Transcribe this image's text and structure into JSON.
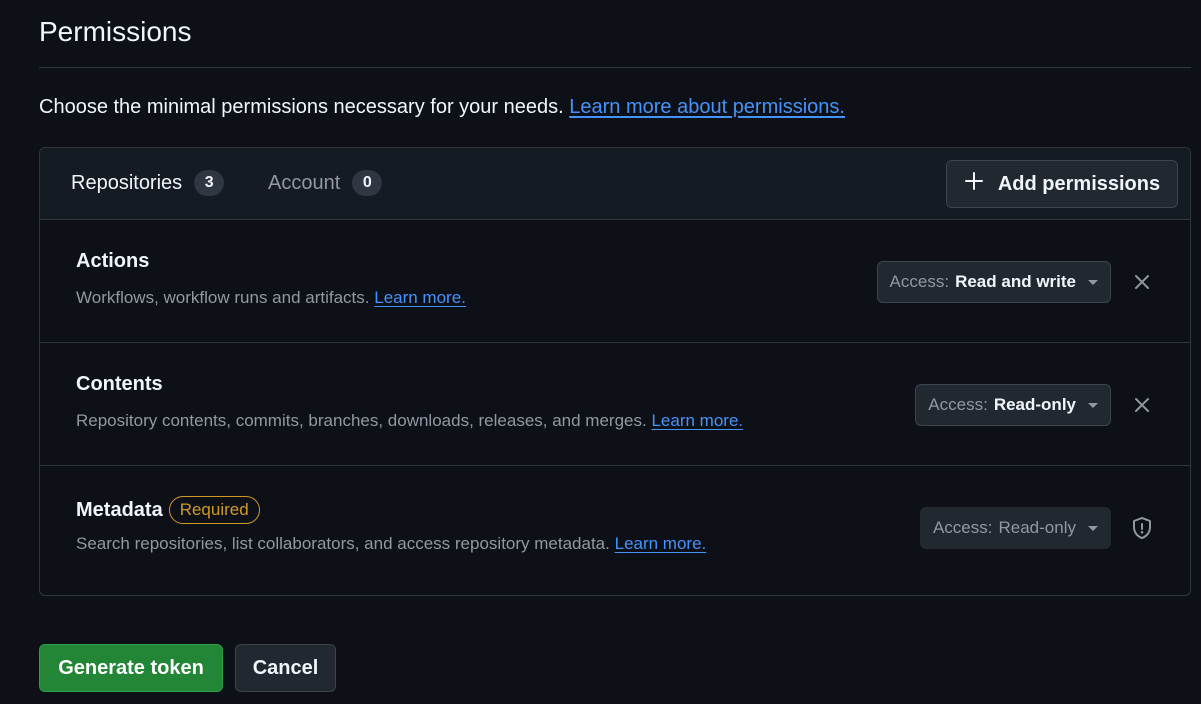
{
  "page": {
    "title": "Permissions",
    "intro_text": "Choose the minimal permissions necessary for your needs.",
    "intro_link": "Learn more about permissions."
  },
  "tabs": [
    {
      "label": "Repositories",
      "count": "3"
    },
    {
      "label": "Account",
      "count": "0"
    }
  ],
  "add_permissions_label": "Add permissions",
  "permissions": [
    {
      "title": "Actions",
      "description": "Workflows, workflow runs and artifacts.",
      "link": "Learn more.",
      "access_prefix": "Access:",
      "access_value": "Read and write",
      "removable": true
    },
    {
      "title": "Contents",
      "description": "Repository contents, commits, branches, downloads, releases, and merges.",
      "link": "Learn more.",
      "access_prefix": "Access:",
      "access_value": "Read-only",
      "removable": true
    },
    {
      "title": "Metadata",
      "badge": "Required",
      "description": "Search repositories, list collaborators, and access repository metadata.",
      "link": "Learn more.",
      "access_prefix": "Access:",
      "access_value": "Read-only",
      "removable": false,
      "icon": "shield-lock-icon"
    }
  ],
  "buttons": {
    "generate": "Generate token",
    "cancel": "Cancel"
  },
  "colors": {
    "background": "#0d1117",
    "link": "#4493f8",
    "required_badge": "#d29922",
    "primary_button": "#238636"
  }
}
